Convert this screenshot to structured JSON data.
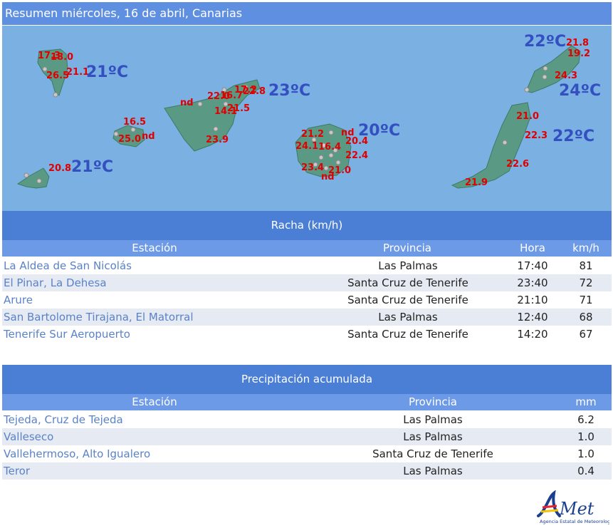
{
  "header": {
    "title": "Resumen miércoles, 16 de abril, Canarias"
  },
  "map": {
    "red_labels": [
      "17.3",
      "18.0",
      "26.5",
      "21.1",
      "16.5",
      "25.0",
      "nd",
      "20.8",
      "nd",
      "22.0",
      "16.7",
      "17.2",
      "22.8",
      "14.1",
      "21.5",
      "23.9",
      "21.2",
      "nd",
      "24.1",
      "16.4",
      "20.4",
      "22.4",
      "23.4",
      "21.0",
      "nd",
      "21.8",
      "19.2",
      "24.3",
      "21.0",
      "22.3",
      "22.6",
      "21.9"
    ],
    "blue_labels": [
      "21ºC",
      "21ºC",
      "23ºC",
      "20ºC",
      "22ºC",
      "24ºC",
      "22ºC"
    ]
  },
  "racha": {
    "title": "Racha (km/h)",
    "columns": [
      "Estación",
      "Provincia",
      "Hora",
      "km/h"
    ],
    "rows": [
      [
        "La Aldea de San Nicolás",
        "Las Palmas",
        "17:40",
        "81"
      ],
      [
        "El Pinar, La Dehesa",
        "Santa Cruz de Tenerife",
        "23:40",
        "72"
      ],
      [
        "Arure",
        "Santa Cruz de Tenerife",
        "21:10",
        "71"
      ],
      [
        "San Bartolome Tirajana, El Matorral",
        "Las Palmas",
        "12:40",
        "68"
      ],
      [
        "Tenerife Sur Aeropuerto",
        "Santa Cruz de Tenerife",
        "14:20",
        "67"
      ]
    ]
  },
  "precip": {
    "title": "Precipitación acumulada",
    "columns": [
      "Estación",
      "Provincia",
      "mm"
    ],
    "rows": [
      [
        "Tejeda, Cruz de Tejeda",
        "Las Palmas",
        "6.2"
      ],
      [
        "Valleseco",
        "Las Palmas",
        "1.0"
      ],
      [
        "Vallehermoso, Alto Igualero",
        "Santa Cruz de Tenerife",
        "1.0"
      ],
      [
        "Teror",
        "Las Palmas",
        "0.4"
      ]
    ]
  },
  "logo": {
    "wordmark": "AEMet",
    "caption": "Agencia Estatal de Meteorología"
  },
  "colors": {
    "header_bg": "#5f8fe0",
    "sea": "#7ab0e2",
    "island": "#5a9a84",
    "temp_red": "#e00000",
    "temp_blue": "#3450c0",
    "link": "#5a82c8"
  }
}
